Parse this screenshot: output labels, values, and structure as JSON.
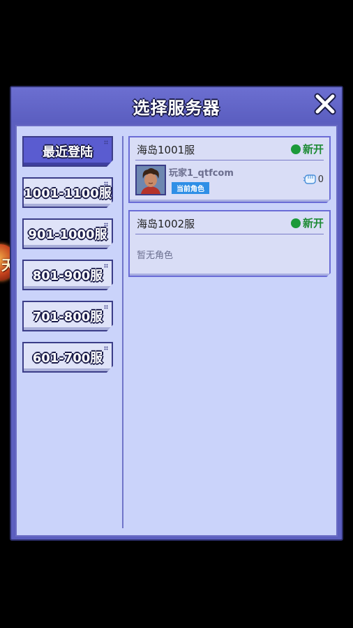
{
  "dialog": {
    "title": "选择服务器",
    "close_icon": "close-icon"
  },
  "tabs": [
    {
      "label": "最近登陆",
      "active": true
    },
    {
      "label": "1001-1100服",
      "active": false
    },
    {
      "label": "901-1000服",
      "active": false
    },
    {
      "label": "801-900服",
      "active": false
    },
    {
      "label": "701-800服",
      "active": false
    },
    {
      "label": "601-700服",
      "active": false
    }
  ],
  "servers": [
    {
      "name": "海岛1001服",
      "status": "新开",
      "status_color": "#1c9a3a",
      "role": {
        "player_name": "玩家1_qtfcom",
        "badge": "当前角色",
        "power_icon": "fist-icon",
        "power": "0"
      }
    },
    {
      "name": "海岛1002服",
      "status": "新开",
      "status_color": "#1c9a3a",
      "empty_text": "暂无角色"
    }
  ],
  "background_badge_text": "天"
}
